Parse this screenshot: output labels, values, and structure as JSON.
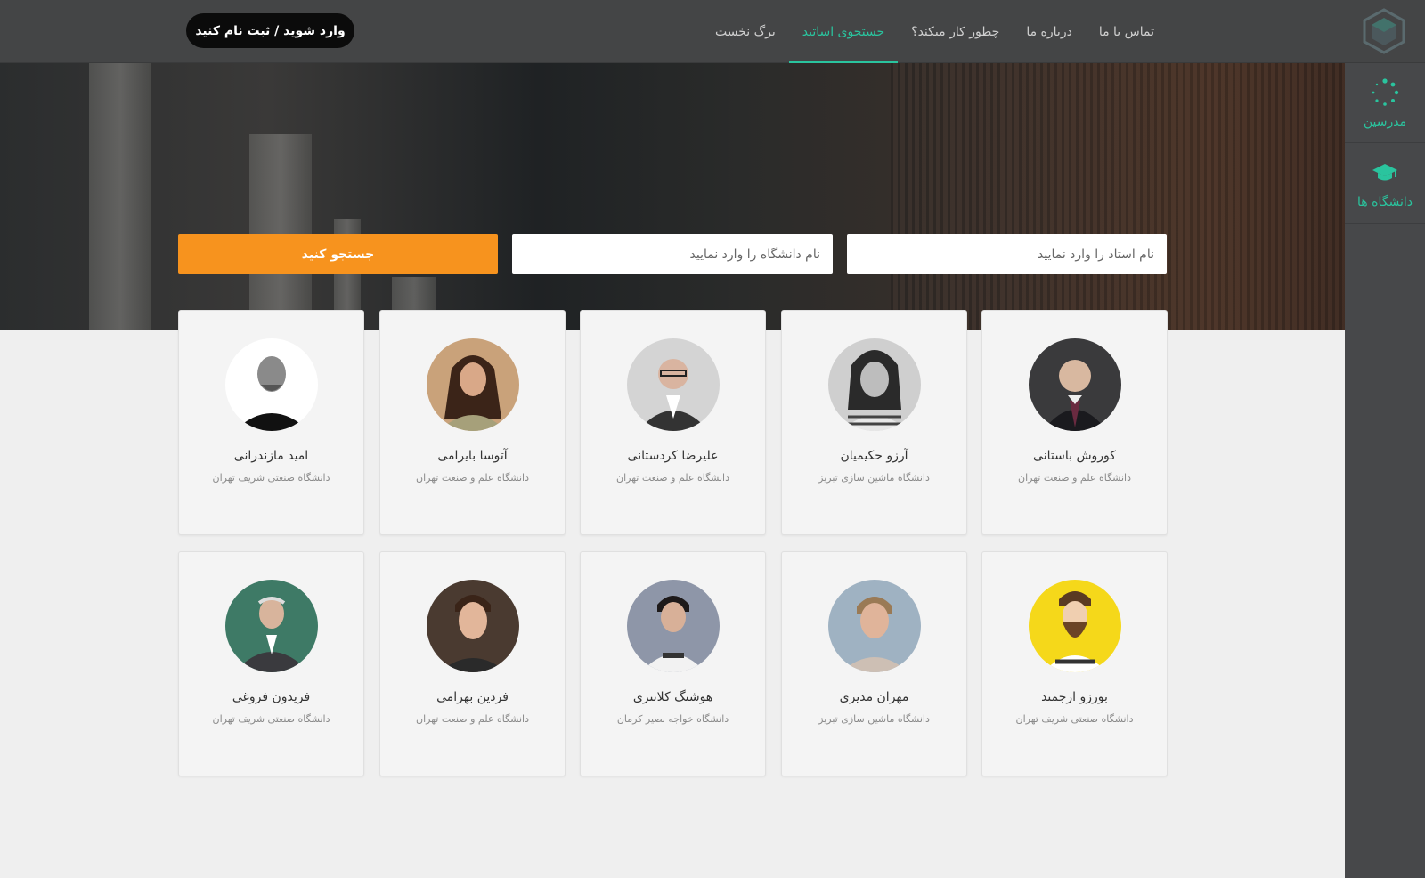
{
  "header": {
    "login_label": "وارد شوید / ثبت نام کنید",
    "nav": [
      {
        "label": "برگ نخست",
        "active": false
      },
      {
        "label": "جستجوی اساتید",
        "active": true
      },
      {
        "label": "چطور کار میکند؟",
        "active": false
      },
      {
        "label": "درباره ما",
        "active": false
      },
      {
        "label": "تماس با ما",
        "active": false
      }
    ],
    "accent_color": "#2ac49e"
  },
  "sidebar": {
    "items": [
      {
        "label": "مدرسین",
        "icon": "spinner-dots-icon"
      },
      {
        "label": "دانشگاه ها",
        "icon": "graduation-cap-icon"
      }
    ]
  },
  "search": {
    "teacher_placeholder": "نام استاد را وارد نمایید",
    "university_placeholder": "نام دانشگاه را وارد نمایید",
    "button_label": "جستجو کنید",
    "button_color": "#f7931e"
  },
  "teachers": [
    {
      "name": "کوروش باستانی",
      "university": "دانشگاه علم و صنعت تهران"
    },
    {
      "name": "آرزو حکیمیان",
      "university": "دانشگاه ماشین سازی تبریز"
    },
    {
      "name": "علیرضا کردستانی",
      "university": "دانشگاه علم و صنعت تهران"
    },
    {
      "name": "آتوسا بایرامی",
      "university": "دانشگاه علم و صنعت تهران"
    },
    {
      "name": "امید مازندرانی",
      "university": "دانشگاه صنعتی شریف تهران"
    },
    {
      "name": "بورزو ارجمند",
      "university": "دانشگاه صنعتی شریف تهران"
    },
    {
      "name": "مهران مدیری",
      "university": "دانشگاه ماشین سازی تبریز"
    },
    {
      "name": "هوشنگ کلانتری",
      "university": "دانشگاه خواجه نصیر کرمان"
    },
    {
      "name": "فردین بهرامی",
      "university": "دانشگاه علم و صنعت تهران"
    },
    {
      "name": "فریدون فروغی",
      "university": "دانشگاه صنعتی شریف تهران"
    }
  ]
}
